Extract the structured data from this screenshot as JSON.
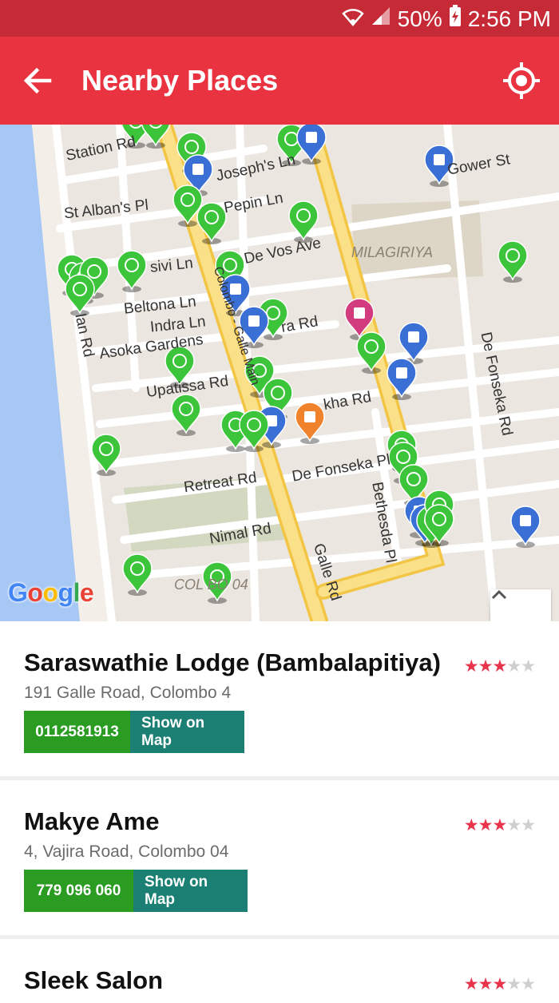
{
  "status_bar": {
    "battery": "50%",
    "time": "2:56 PM",
    "icons": [
      "wifi-icon",
      "signal-icon",
      "battery-charging-icon"
    ]
  },
  "app_bar": {
    "title": "Nearby Places",
    "back_icon": "arrow-left-icon",
    "location_icon": "my-location-icon"
  },
  "map": {
    "labels": [
      "Station Rd",
      "Joseph's Ln",
      "Gower St",
      "St Alban's Pl",
      "Pepin Ln",
      "MILAGIRIYA",
      "De Vos Ave",
      "sivi Ln",
      "Beltona Ln",
      "Indra Ln",
      "Asoka Gardens",
      "ra Rd",
      "Upatissa Rd",
      "kha Rd",
      "De Fonseka Pl",
      "Retreat Rd",
      "Nimal Rd",
      "De Fonseka Rd",
      "Bethesda Pl",
      "Galle Rd",
      "COL BO 04",
      "lan Rd",
      "Colombo - Galle Main"
    ],
    "logo": "Google",
    "expand_icon": "chevron-up-icon"
  },
  "places": [
    {
      "name": "Saraswathie Lodge (Bambalapitiya)",
      "address": "191 Galle Road, Colombo 4",
      "phone": "0112581913",
      "map_button": "Show on Map",
      "rating": 3
    },
    {
      "name": "Makye Ame",
      "address": "4, Vajira Road, Colombo 04",
      "phone": "779 096 060",
      "map_button": "Show on Map",
      "rating": 3
    },
    {
      "name": "Sleek Salon",
      "rating": 3
    }
  ],
  "colors": {
    "accent": "#ea3340",
    "status": "#c62a36",
    "phone_btn": "#2a9c22",
    "map_btn": "#1b7f74",
    "pin_food": "#3cc43a",
    "pin_shop": "#3a6fd6",
    "pin_photo": "#d23b7e",
    "pin_bar": "#f0822b"
  }
}
